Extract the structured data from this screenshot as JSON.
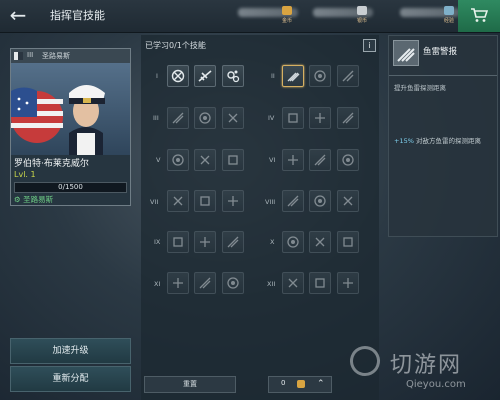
{
  "header": {
    "title": "指挥官技能",
    "resources": [
      {
        "name": "gold",
        "label": "金币"
      },
      {
        "name": "silver",
        "label": "银币"
      },
      {
        "name": "xp",
        "label": "经验"
      }
    ]
  },
  "captain": {
    "rank": "III",
    "nation_ship": "圣路易斯",
    "name": "罗伯特·布莱克威尔",
    "level": "Lvl. 1",
    "xp": "0/1500",
    "ship": "圣路易斯"
  },
  "buttons": {
    "accelerate": "加速升级",
    "reassign": "重新分配",
    "reset": "重置"
  },
  "skills": {
    "learned": "已学习0/1个技能",
    "info": "i",
    "tiers": [
      "I",
      "II",
      "III",
      "IV",
      "V",
      "VI",
      "VII",
      "VIII",
      "IX",
      "X",
      "XI",
      "XII"
    ]
  },
  "points": {
    "value": "0"
  },
  "detail": {
    "title": "鱼雷警报",
    "description": "提升鱼雷探测距离",
    "effect_value": "+15%",
    "effect_text": "对敌方鱼雷的探测距离"
  },
  "watermark": {
    "text": "切游网",
    "url": "Qieyou.com"
  },
  "colors": {
    "accent": "#2f8a61",
    "level": "#c9d64a",
    "ship": "#6fcf86",
    "selected": "#d6b062"
  }
}
